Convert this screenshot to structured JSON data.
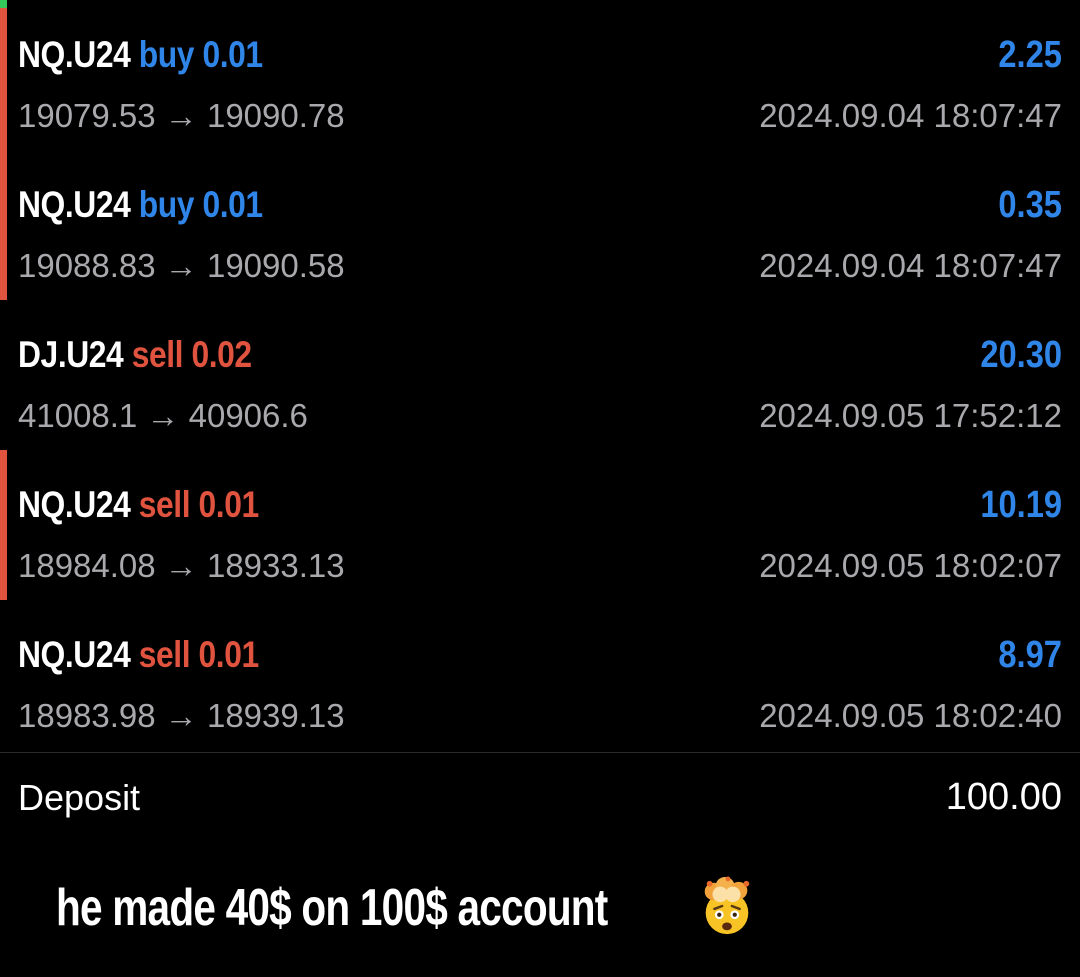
{
  "trades": [
    {
      "symbol": "NQ.U24",
      "type": "buy",
      "volume": "0.01",
      "type_volume": "buy 0.01",
      "open_price": "19079.53",
      "close_price": "19090.78",
      "arrow": "→",
      "prices": "19079.53 → 19090.78",
      "profit": "2.25",
      "time": "2024.09.04 18:07:47"
    },
    {
      "symbol": "NQ.U24",
      "type": "buy",
      "volume": "0.01",
      "type_volume": "buy 0.01",
      "open_price": "19088.83",
      "close_price": "19090.58",
      "arrow": "→",
      "prices": "19088.83 → 19090.58",
      "profit": "0.35",
      "time": "2024.09.04 18:07:47"
    },
    {
      "symbol": "DJ.U24",
      "type": "sell",
      "volume": "0.02",
      "type_volume": "sell 0.02",
      "open_price": "41008.1",
      "close_price": "40906.6",
      "arrow": "→",
      "prices": "41008.1 → 40906.6",
      "profit": "20.30",
      "time": "2024.09.05 17:52:12"
    },
    {
      "symbol": "NQ.U24",
      "type": "sell",
      "volume": "0.01",
      "type_volume": "sell 0.01",
      "open_price": "18984.08",
      "close_price": "18933.13",
      "arrow": "→",
      "prices": "18984.08 → 18933.13",
      "profit": "10.19",
      "time": "2024.09.05 18:02:07"
    },
    {
      "symbol": "NQ.U24",
      "type": "sell",
      "volume": "0.01",
      "type_volume": "sell 0.01",
      "open_price": "18983.98",
      "close_price": "18939.13",
      "arrow": "→",
      "prices": "18983.98 → 18939.13",
      "profit": "8.97",
      "time": "2024.09.05 18:02:40"
    }
  ],
  "deposit": {
    "label": "Deposit",
    "value": "100.00"
  },
  "caption": {
    "text": "he made 40$ on 100$ account",
    "emoji": "exploding-head-icon"
  },
  "colors": {
    "background": "#000000",
    "buy": "#2f86e8",
    "sell": "#e0533f",
    "profit": "#2f86e8",
    "secondary_text": "#a9a9ad",
    "bar_red": "#e0533f",
    "bar_green": "#34c759"
  }
}
